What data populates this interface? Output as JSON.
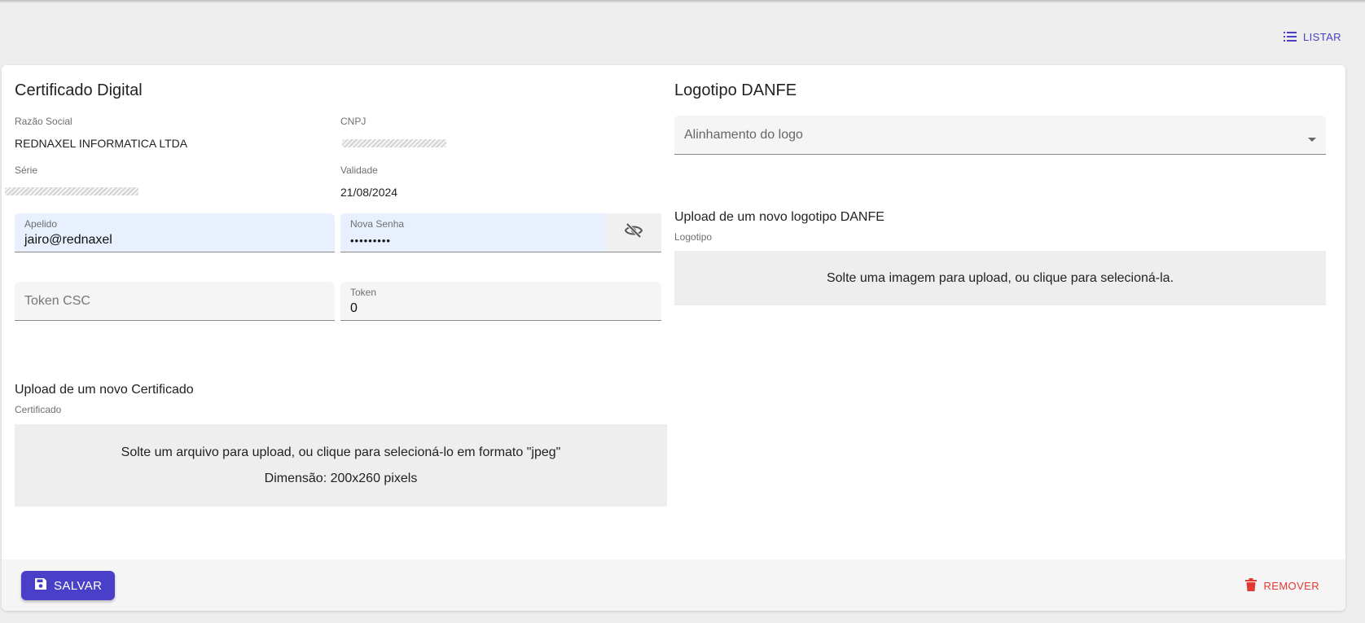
{
  "header": {
    "list_label": "LISTAR",
    "list_icon": "list-icon"
  },
  "certificate": {
    "title": "Certificado Digital",
    "razao_social_label": "Razão Social",
    "razao_social_value": "REDNAXEL INFORMATICA LTDA",
    "cnpj_label": "CNPJ",
    "serie_label": "Série",
    "validade_label": "Validade",
    "validade_value": "21/08/2024",
    "apelido_label": "Apelido",
    "apelido_value": "jairo@rednaxel",
    "nova_senha_label": "Nova Senha",
    "nova_senha_value": "•••••••••",
    "visibility_icon": "eye-off-icon",
    "token_csc_placeholder": "Token CSC",
    "token_label": "Token",
    "token_value": "0",
    "upload_title": "Upload de um novo Certificado",
    "upload_sublabel": "Certificado",
    "dropzone_text": "Solte um arquivo para upload, ou clique para selecioná-lo em formato \"jpeg\"",
    "dropzone_dimension": "Dimensão: 200x260 pixels"
  },
  "logo": {
    "title": "Logotipo DANFE",
    "alignment_placeholder": "Alinhamento do logo",
    "upload_title": "Upload de um novo logotipo DANFE",
    "upload_sublabel": "Logotipo",
    "dropzone_text": "Solte uma imagem para upload, ou clique para selecioná-la."
  },
  "footer": {
    "save_label": "SALVAR",
    "save_icon": "floppy-disk-icon",
    "remove_label": "REMOVER",
    "remove_icon": "trash-icon"
  },
  "colors": {
    "accent": "#4a3fc8",
    "danger": "#e53935",
    "autofill_background": "#e8f0fe"
  }
}
